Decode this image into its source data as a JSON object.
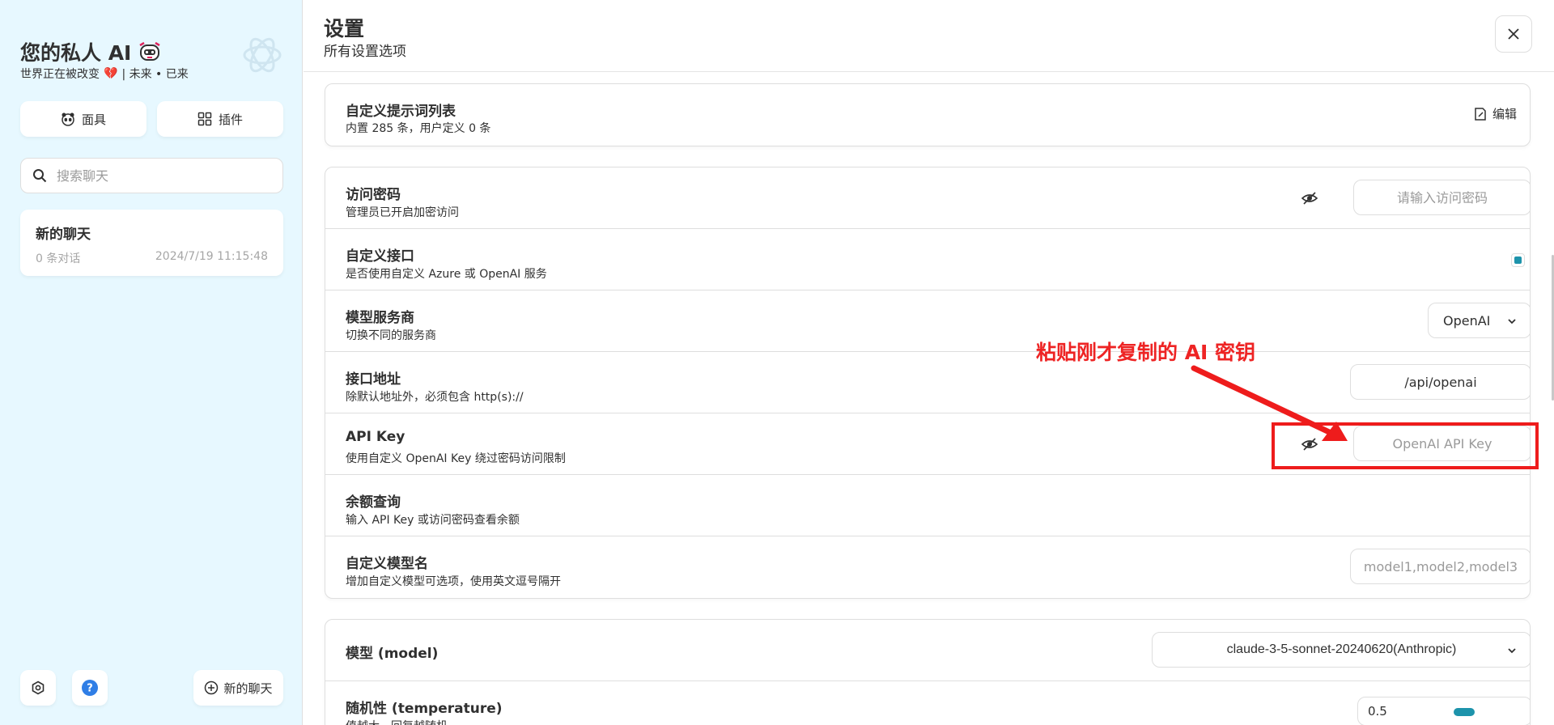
{
  "sidebar": {
    "title": "您的私人 AI",
    "subtitle_left": "世界正在被改变",
    "subtitle_right": "| 未来 • 已来",
    "mask_button": "面具",
    "plugin_button": "插件",
    "search_placeholder": "搜索聊天",
    "chat": {
      "title": "新的聊天",
      "count": "0 条对话",
      "time": "2024/7/19 11:15:48"
    },
    "new_chat_button": "新的聊天"
  },
  "header": {
    "title": "设置",
    "subtitle": "所有设置选项"
  },
  "prompt_card": {
    "title": "自定义提示词列表",
    "sub": "内置 285 条，用户定义 0 条",
    "edit_label": "编辑"
  },
  "rows": {
    "access_code": {
      "title": "访问密码",
      "sub": "管理员已开启加密访问",
      "placeholder": "请输入访问密码"
    },
    "custom_endpoint": {
      "title": "自定义接口",
      "sub": "是否使用自定义 Azure 或 OpenAI 服务",
      "checked": true
    },
    "provider": {
      "title": "模型服务商",
      "sub": "切换不同的服务商",
      "value": "OpenAI"
    },
    "endpoint": {
      "title": "接口地址",
      "sub": "除默认地址外，必须包含 http(s)://",
      "value": "/api/openai"
    },
    "api_key": {
      "title": "API Key",
      "sub": "使用自定义 OpenAI Key 绕过密码访问限制",
      "placeholder": "OpenAI API Key"
    },
    "balance": {
      "title": "余额查询",
      "sub": "输入 API Key 或访问密码查看余额"
    },
    "custom_models": {
      "title": "自定义模型名",
      "sub": "增加自定义模型可选项，使用英文逗号隔开",
      "placeholder": "model1,model2,model3"
    }
  },
  "model_card": {
    "model": {
      "title": "模型 (model)",
      "value": "claude-3-5-sonnet-20240620(Anthropic)"
    },
    "temperature": {
      "title": "随机性 (temperature)",
      "sub": "值越大，回复越随机",
      "value": "0.5"
    }
  },
  "annotation": {
    "text": "粘贴刚才复制的 AI 密钥",
    "color": "#ee2424"
  },
  "colors": {
    "sidebar_bg": "#e7f8ff",
    "accent": "#1d93ab"
  }
}
